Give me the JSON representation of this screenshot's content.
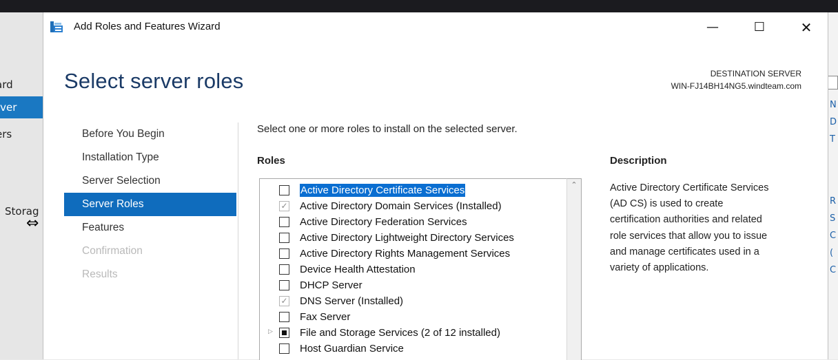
{
  "background": {
    "nav_fragments": [
      "ard",
      "rver",
      "ers"
    ],
    "storage_fragment": "Storag",
    "right_fragments": [
      "N",
      "D",
      "T",
      "R",
      "S",
      "C",
      "(",
      "C"
    ]
  },
  "window": {
    "title": "Add Roles and Features Wizard",
    "minimize": "—",
    "maximize": "☐",
    "close": "✕"
  },
  "page_title": "Select server roles",
  "destination": {
    "label": "DESTINATION SERVER",
    "server": "WIN-FJ14BH14NG5.windteam.com"
  },
  "steps": [
    {
      "label": "Before You Begin",
      "state": "normal"
    },
    {
      "label": "Installation Type",
      "state": "normal"
    },
    {
      "label": "Server Selection",
      "state": "normal"
    },
    {
      "label": "Server Roles",
      "state": "active"
    },
    {
      "label": "Features",
      "state": "normal"
    },
    {
      "label": "Confirmation",
      "state": "disabled"
    },
    {
      "label": "Results",
      "state": "disabled"
    }
  ],
  "instruction": "Select one or more roles to install on the selected server.",
  "roles_header": "Roles",
  "roles": [
    {
      "label": "Active Directory Certificate Services",
      "state": "unchecked",
      "selected": true
    },
    {
      "label": "Active Directory Domain Services (Installed)",
      "state": "installed"
    },
    {
      "label": "Active Directory Federation Services",
      "state": "unchecked"
    },
    {
      "label": "Active Directory Lightweight Directory Services",
      "state": "unchecked"
    },
    {
      "label": "Active Directory Rights Management Services",
      "state": "unchecked"
    },
    {
      "label": "Device Health Attestation",
      "state": "unchecked"
    },
    {
      "label": "DHCP Server",
      "state": "unchecked"
    },
    {
      "label": "DNS Server (Installed)",
      "state": "installed"
    },
    {
      "label": "Fax Server",
      "state": "unchecked"
    },
    {
      "label": "File and Storage Services (2 of 12 installed)",
      "state": "partial",
      "expandable": true
    },
    {
      "label": "Host Guardian Service",
      "state": "unchecked"
    }
  ],
  "description_header": "Description",
  "description_lines": [
    "Active Directory Certificate Services",
    "(AD CS) is used to create",
    "certification authorities and related",
    "role services that allow you to issue",
    "and manage certificates used in a",
    "variety of applications."
  ],
  "colors": {
    "accent": "#0f6cbd",
    "title": "#1a3a66",
    "selection": "#0a6ed1"
  }
}
